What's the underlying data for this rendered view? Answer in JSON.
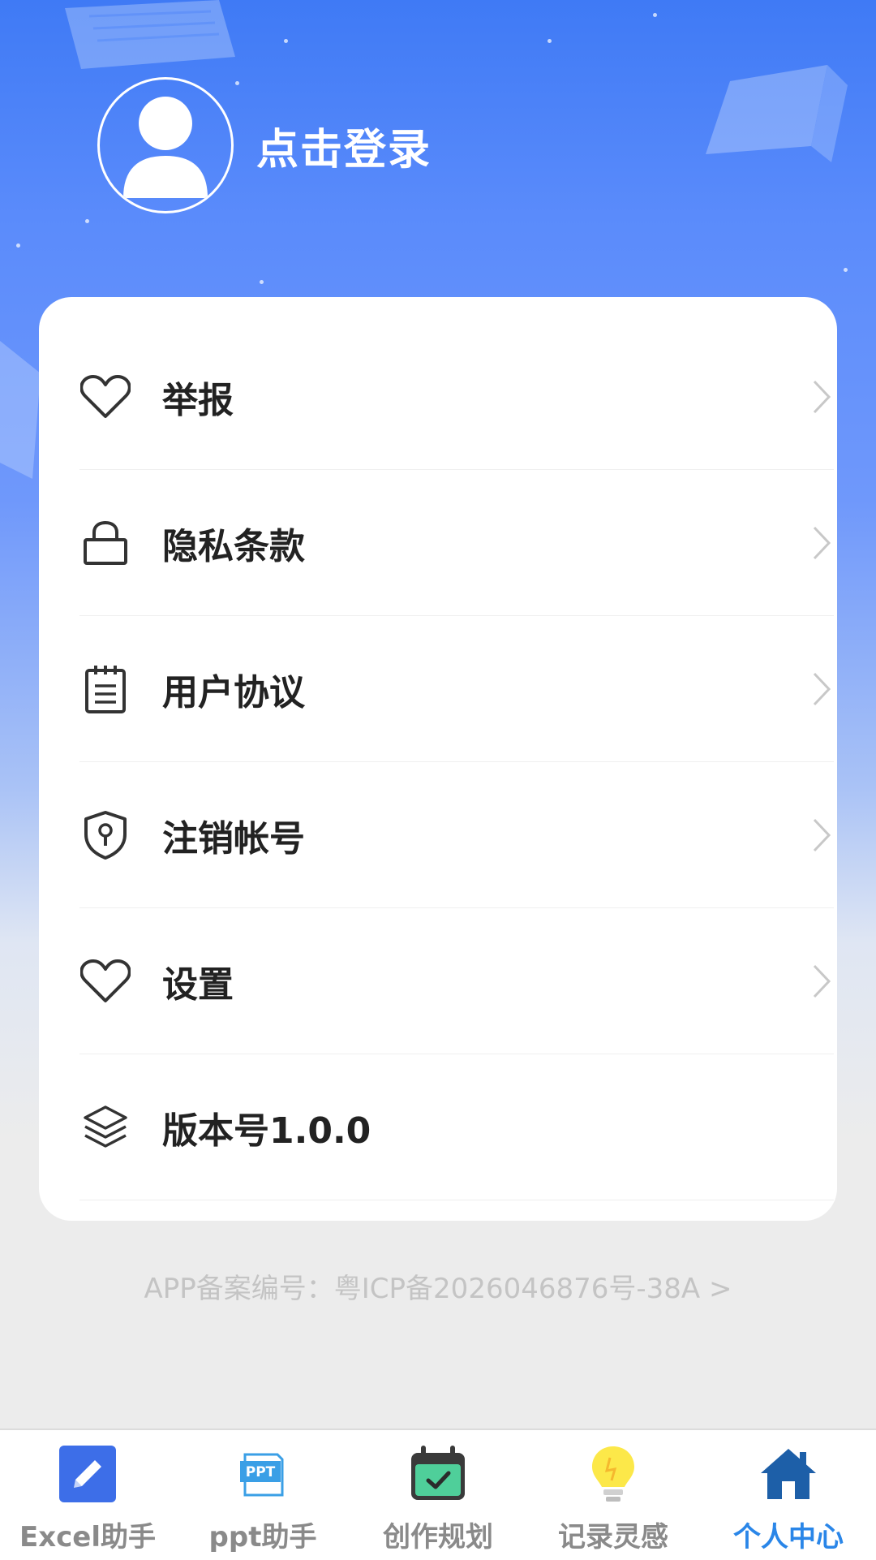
{
  "header": {
    "login_label": "点击登录"
  },
  "menu": {
    "items": [
      {
        "label": "举报",
        "icon": "heart-icon"
      },
      {
        "label": "隐私条款",
        "icon": "lock-icon"
      },
      {
        "label": "用户协议",
        "icon": "notepad-icon"
      },
      {
        "label": "注销帐号",
        "icon": "shield-icon"
      },
      {
        "label": "设置",
        "icon": "heart-icon"
      },
      {
        "label": "版本号1.0.0",
        "icon": "layers-icon"
      }
    ]
  },
  "footer": {
    "icp": "APP备案编号：粤ICP备2026046876号-38A >"
  },
  "tabbar": {
    "tabs": [
      {
        "label": "Excel助手",
        "icon": "pencil-icon"
      },
      {
        "label": "ppt助手",
        "icon": "ppt-icon"
      },
      {
        "label": "创作规划",
        "icon": "calendar-check-icon"
      },
      {
        "label": "记录灵感",
        "icon": "lightbulb-icon"
      },
      {
        "label": "个人中心",
        "icon": "home-icon"
      }
    ],
    "active_index": 4
  },
  "colors": {
    "header_blue": "#3f7af5",
    "active_tab": "#2a86e8",
    "inactive_tab": "#8a8a8a"
  }
}
